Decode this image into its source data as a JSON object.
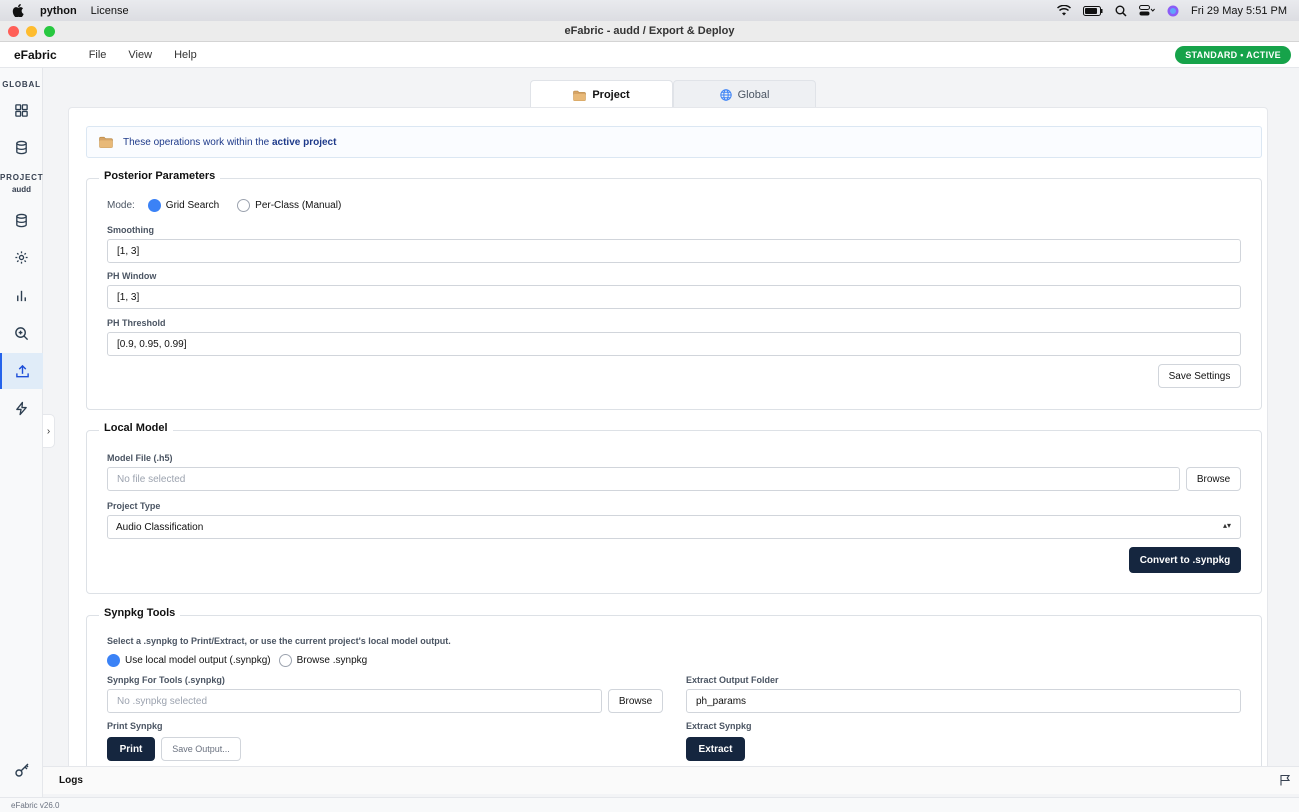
{
  "os_menubar": {
    "app": "python",
    "items": [
      "License"
    ],
    "datetime": "Fri 29 May  5:51 PM"
  },
  "window": {
    "title": "eFabric - audd / Export & Deploy"
  },
  "app": {
    "brand": "eFabric",
    "menus": [
      "File",
      "View",
      "Help"
    ],
    "badge": "STANDARD • ACTIVE",
    "version": "eFabric v26.0"
  },
  "sidebar": {
    "global_label": "GLOBAL",
    "project_label": "PROJECT",
    "project_name": "audd",
    "items": [
      {
        "icon": "grid-icon"
      },
      {
        "icon": "database-icon"
      },
      {
        "icon": "database-icon"
      },
      {
        "icon": "cog-icon"
      },
      {
        "icon": "bar-chart-icon"
      },
      {
        "icon": "zoom-icon"
      },
      {
        "icon": "upload-icon",
        "active": true
      },
      {
        "icon": "bolt-icon"
      }
    ]
  },
  "tabs": [
    {
      "label": "Project",
      "active": true
    },
    {
      "label": "Global",
      "active": false
    }
  ],
  "notice": {
    "prefix": "These operations work within the",
    "emphasis": "active project"
  },
  "posterior": {
    "title": "Posterior Parameters",
    "mode_label": "Mode:",
    "modes": [
      {
        "label": "Grid Search",
        "selected": true
      },
      {
        "label": "Per-Class (Manual)",
        "selected": false
      }
    ],
    "smoothing_label": "Smoothing",
    "smoothing_value": "[1, 3]",
    "ph_window_label": "PH Window",
    "ph_window_value": "[1, 3]",
    "ph_threshold_label": "PH Threshold",
    "ph_threshold_value": "[0.9, 0.95, 0.99]",
    "save_label": "Save Settings"
  },
  "local_model": {
    "title": "Local Model",
    "model_file_label": "Model File (.h5)",
    "model_file_placeholder": "No file selected",
    "browse_label": "Browse",
    "project_type_label": "Project Type",
    "project_type_value": "Audio Classification",
    "convert_label": "Convert to .synpkg"
  },
  "synpkg": {
    "title": "Synpkg Tools",
    "description": "Select a .synpkg to Print/Extract, or use the current project's local model output.",
    "sources": [
      {
        "label": "Use local model output (.synpkg)",
        "selected": true
      },
      {
        "label": "Browse .synpkg",
        "selected": false
      }
    ],
    "synpkg_label": "Synpkg For Tools (.synpkg)",
    "synpkg_placeholder": "No .synpkg selected",
    "browse_label": "Browse",
    "extract_folder_label": "Extract Output Folder",
    "extract_folder_value": "ph_params",
    "print_section_label": "Print Synpkg",
    "print_label": "Print",
    "save_output_label": "Save Output...",
    "extract_section_label": "Extract Synpkg",
    "extract_label": "Extract"
  },
  "logs": {
    "label": "Logs"
  },
  "colors": {
    "accent": "#3b82f6",
    "primary_button": "#15263f",
    "badge": "#16a34a"
  }
}
